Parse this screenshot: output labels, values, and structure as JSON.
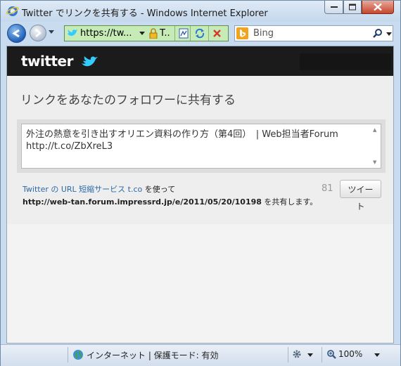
{
  "window": {
    "title": "Twitter でリンクを共有する - Windows Internet Explorer"
  },
  "navbar": {
    "address_text": "https://tw...",
    "tab_short_label": "T..",
    "search_placeholder": "Bing"
  },
  "page": {
    "heading": "リンクをあなたのフォロワーに共有する",
    "tweet_text_line1": "外注の熱意を引き出すオリエン資料の作り方（第4回）　| Web担当者Forum",
    "tweet_text_line2": "http://t.co/ZbXreL3",
    "info_link": "Twitter の URL 短縮サービス t.co",
    "info_suffix": " を使って",
    "share_url": "http://web-tan.forum.impressrd.jp/e/2011/05/20/10198",
    "share_suffix": " を共有します。",
    "char_counter": "81",
    "tweet_button": "ツイート"
  },
  "statusbar": {
    "zone": "インターネット | 保護モード: 有効",
    "zoom": "100%"
  },
  "colors": {
    "twitter_blue": "#33ccff",
    "header_bg": "#1b1b1b",
    "link": "#2b6aa7"
  }
}
